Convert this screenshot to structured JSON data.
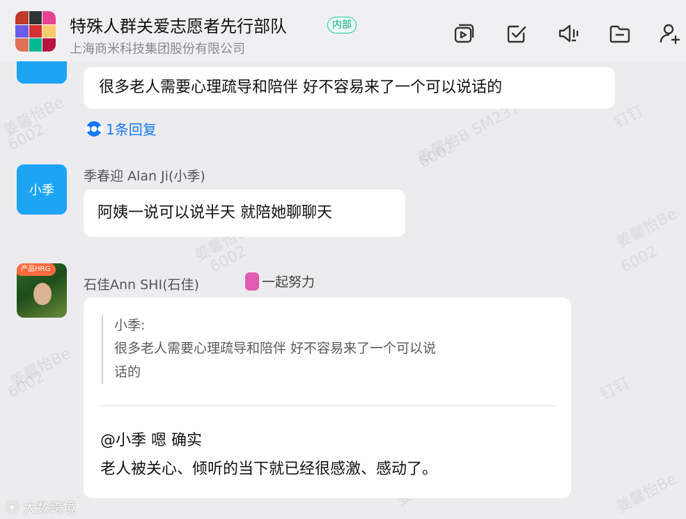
{
  "header": {
    "title": "特殊人群关爱志愿者先行部队",
    "badge": "内部",
    "subtitle": "上海商米科技集团股份有限公司",
    "icons": [
      "screen-share-icon",
      "todo-icon",
      "announcement-icon",
      "folder-icon",
      "add-member-icon"
    ]
  },
  "messages": {
    "m1": {
      "text": "很多老人需要心理疏导和陪伴 好不容易来了一个可以说话的"
    },
    "reply_link": "1条回复",
    "m2": {
      "sender": "季春迎 Alan Ji(小季)",
      "avatar_text": "小季",
      "text": "阿姨一说可以说半天 就陪她聊聊天"
    },
    "m3": {
      "sender": "石佳Ann SHI(石佳)",
      "status": "一起努力",
      "avatar_tag": "产品HRG",
      "quote_name": "小季:",
      "quote_line1": "很多老人需要心理疏导和陪伴 好不容易来了一个可以说",
      "quote_line2": "话的",
      "line1": "@小季  嗯 确实",
      "line2": "老人被关心、倾听的当下就已经很感激、感动了。"
    }
  },
  "watermark": {
    "name": "姜馨怡Be",
    "name2": "姜馨怡B SM2379",
    "code": "6002",
    "app": "钉钉"
  },
  "footer_logo": "大数跨境",
  "colors": {
    "accent": "#1677ff",
    "avatar_blue": "#1ea4f4",
    "badge_green": "#20c997"
  }
}
